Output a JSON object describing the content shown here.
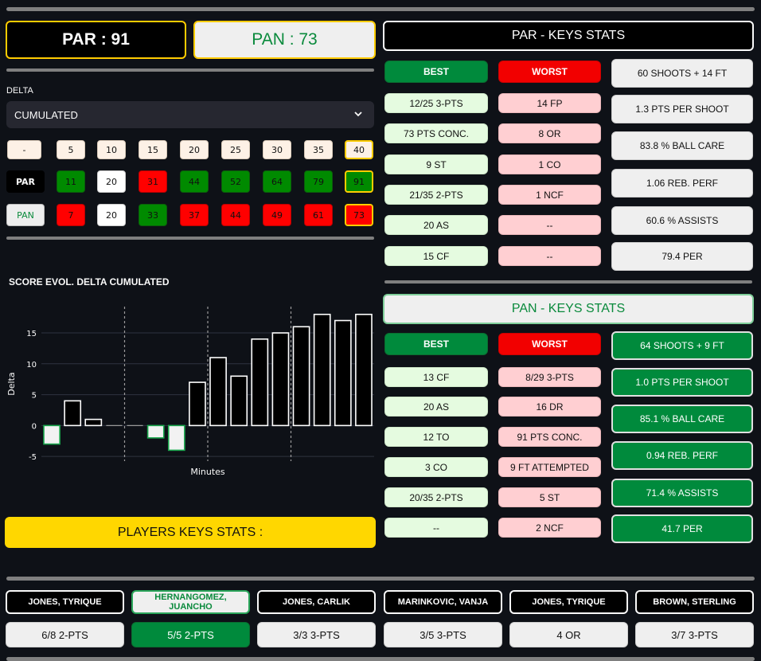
{
  "scores": {
    "home": {
      "label": "PAR : 91"
    },
    "away": {
      "label": "PAN : 73"
    }
  },
  "delta": {
    "label": "DELTA",
    "select_value": "CUMULATED",
    "minutes": [
      "-",
      "5",
      "10",
      "15",
      "20",
      "25",
      "30",
      "35",
      "40"
    ],
    "home_team": "PAR",
    "home_values": [
      "11",
      "20",
      "31",
      "44",
      "52",
      "64",
      "79",
      "91"
    ],
    "away_team": "PAN",
    "away_values": [
      "7",
      "20",
      "33",
      "37",
      "44",
      "49",
      "61",
      "73"
    ]
  },
  "chart_title": "SCORE EVOL. DELTA CUMULATED",
  "chart_data": {
    "type": "bar",
    "title": "",
    "xlabel": "Minutes",
    "ylabel": "Delta",
    "ylim": [
      -5.5,
      19
    ],
    "yticks": [
      -5,
      0,
      5,
      10,
      15
    ],
    "values": [
      -3,
      4,
      1,
      0,
      0,
      -2,
      -4,
      7,
      11,
      8,
      14,
      15,
      16,
      18,
      17,
      18
    ],
    "quarter_lines": true,
    "grid": true
  },
  "players_header": "PLAYERS KEYS STATS :",
  "par_panel": {
    "title": "PAR - KEYS STATS",
    "best_label": "BEST",
    "worst_label": "WORST",
    "best": [
      "12/25 3-PTS",
      "73 PTS CONC.",
      "9 ST",
      "21/35 2-PTS",
      "20 AS",
      "15 CF"
    ],
    "worst": [
      "14 FP",
      "8 OR",
      "1 CO",
      "1 NCF",
      "--",
      "--"
    ],
    "metrics": [
      "60  SHOOTS + 14 FT",
      "1.3  PTS PER SHOOT",
      "83.8 % BALL CARE",
      "1.06 REB. PERF",
      "60.6 % ASSISTS",
      "79.4 PER"
    ]
  },
  "pan_panel": {
    "title": "PAN - KEYS STATS",
    "best_label": "BEST",
    "worst_label": "WORST",
    "best": [
      "13 CF",
      "20 AS",
      "12 TO",
      "3 CO",
      "20/35 2-PTS",
      "--"
    ],
    "worst": [
      "8/29 3-PTS",
      "16 DR",
      "91 PTS CONC.",
      "9 FT ATTEMPTED",
      "5 ST",
      "2 NCF"
    ],
    "metrics": [
      "64  SHOOTS + 9 FT",
      "1.0  PTS PER SHOOT",
      "85.1 % BALL CARE",
      "0.94 REB. PERF",
      "71.4 % ASSISTS",
      "41.7 PER"
    ]
  },
  "players": [
    {
      "name": "JONES, TYRIQUE",
      "stat": "6/8 2-PTS"
    },
    {
      "name": "HERNANGOMEZ, JUANCHO",
      "stat": "5/5 2-PTS"
    },
    {
      "name": "JONES, CARLIK",
      "stat": "3/3 3-PTS"
    },
    {
      "name": "MARINKOVIC, VANJA",
      "stat": "3/5 3-PTS"
    },
    {
      "name": "JONES, TYRIQUE",
      "stat": "4 OR"
    },
    {
      "name": "BROWN, STERLING",
      "stat": "3/7 3-PTS"
    }
  ],
  "colors": {
    "green": "#008a3c",
    "red": "#f20000",
    "yellow": "#ffd700",
    "background": "#0e1117"
  }
}
